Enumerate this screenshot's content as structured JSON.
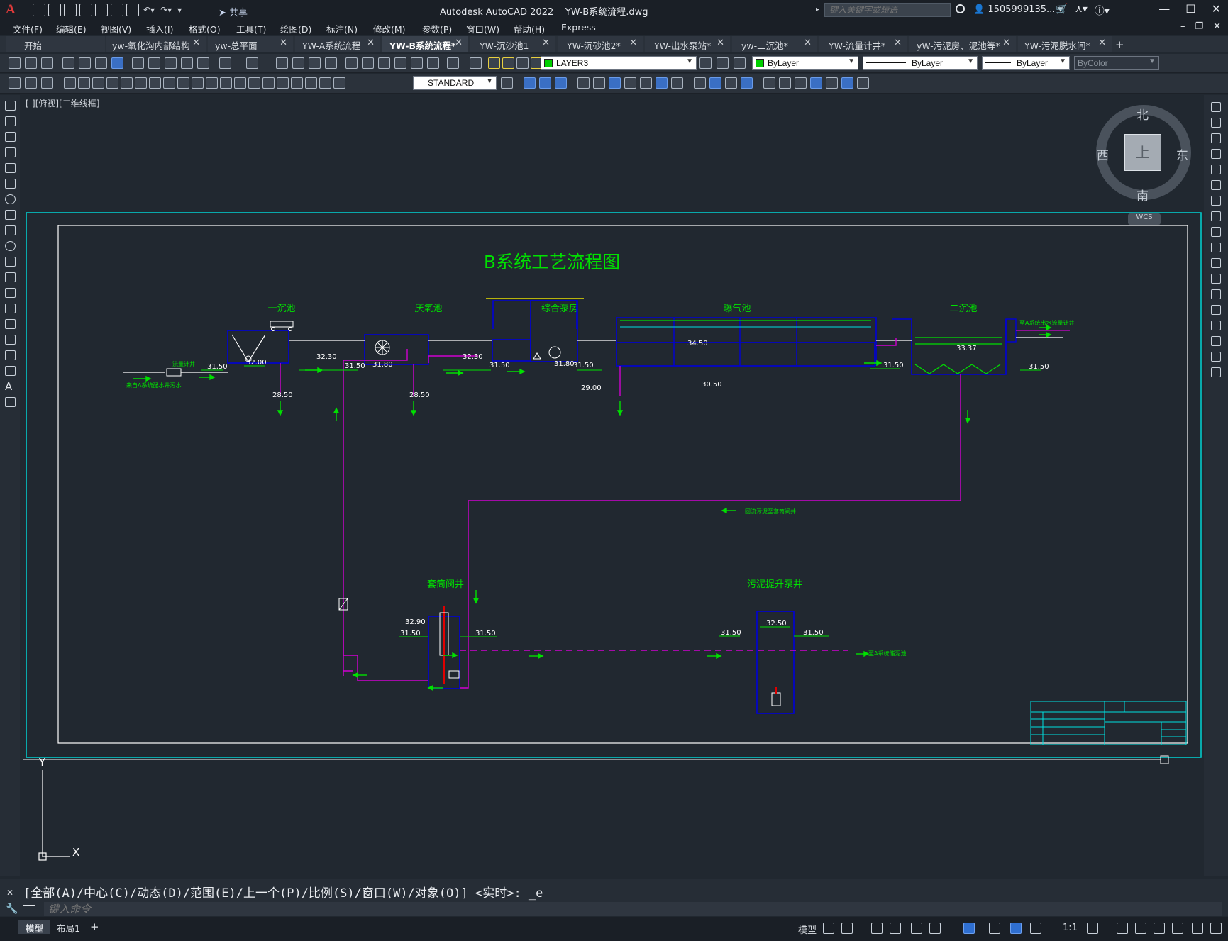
{
  "app": {
    "logo": "A",
    "window_title": "Autodesk AutoCAD 2022    YW-B系统流程.dwg",
    "share_label": "共享",
    "search_placeholder": "键入关键字或短语",
    "user": "1505999135...",
    "help": "?"
  },
  "menu": [
    "文件(F)",
    "编辑(E)",
    "视图(V)",
    "插入(I)",
    "格式(O)",
    "工具(T)",
    "绘图(D)",
    "标注(N)",
    "修改(M)",
    "参数(P)",
    "窗口(W)",
    "帮助(H)",
    "Express"
  ],
  "tabs": [
    {
      "label": "开始",
      "active": false,
      "closable": false
    },
    {
      "label": "yw-氧化沟内部结构",
      "active": false,
      "closable": true
    },
    {
      "label": "yw-总平面",
      "active": false,
      "closable": true
    },
    {
      "label": "YW-A系统流程",
      "active": false,
      "closable": true
    },
    {
      "label": "YW-B系统流程*",
      "active": true,
      "closable": true
    },
    {
      "label": "YW-沉沙池1",
      "active": false,
      "closable": true
    },
    {
      "label": "YW-沉砂池2*",
      "active": false,
      "closable": true
    },
    {
      "label": "YW-出水泵站*",
      "active": false,
      "closable": true
    },
    {
      "label": "yw-二沉池*",
      "active": false,
      "closable": true
    },
    {
      "label": "YW-流量计井*",
      "active": false,
      "closable": true
    },
    {
      "label": "yW-污泥房、泥池等*",
      "active": false,
      "closable": true
    },
    {
      "label": "YW-污泥脱水间*",
      "active": false,
      "closable": true
    }
  ],
  "properties": {
    "layer": "LAYER3",
    "layer_color": "#00d000",
    "color": "ByLayer",
    "linetype": "ByLayer",
    "lineweight": "ByLayer",
    "plotstyle": "ByColor",
    "textstyle": "STANDARD"
  },
  "viewport": {
    "label": "[-][俯视][二维线框]",
    "viewcube": {
      "north": "北",
      "south": "南",
      "east": "东",
      "west": "西",
      "face": "上",
      "wcs": "WCS"
    }
  },
  "drawing": {
    "title": "B系统工艺流程图",
    "units": {
      "primary": [
        "一沉池",
        "厌氧池",
        "综合泵房",
        "曝气池",
        "二沉池"
      ],
      "secondary": [
        "套筒阀井",
        "污泥提升泵井"
      ]
    },
    "elevations": [
      "31.50",
      "32.00",
      "28.50",
      "32.30",
      "31.50",
      "31.80",
      "28.50",
      "32.30",
      "31.50",
      "31.80",
      "31.50",
      "29.00",
      "34.50",
      "30.50",
      "31.50",
      "33.37",
      "31.50",
      "32.90",
      "31.50",
      "31.50",
      "32.50",
      "31.50",
      "31.50"
    ],
    "small_labels": {
      "flow_meter": "流量计井",
      "inlet": "来自A系统配水井污水",
      "outlet": "至A系统出水流量计井",
      "sludge_return": "回流污泥至套筒阀井",
      "sludge_outlet": "至A系统储泥池"
    },
    "colors": {
      "frame": "#00e0e0",
      "green": "#00e000",
      "blue": "#0000d8",
      "magenta": "#d000d0",
      "white": "#ffffff",
      "yellow": "#e8e000",
      "red": "#e00000"
    },
    "axes": {
      "x": "X",
      "y": "Y"
    }
  },
  "command": {
    "history": "[全部(A)/中心(C)/动态(D)/范围(E)/上一个(P)/比例(S)/窗口(W)/对象(O)] <实时>: _e",
    "placeholder": "键入命令"
  },
  "status": {
    "layouts": [
      "模型",
      "布局1"
    ],
    "model_label": "模型",
    "scale": "1:1"
  }
}
